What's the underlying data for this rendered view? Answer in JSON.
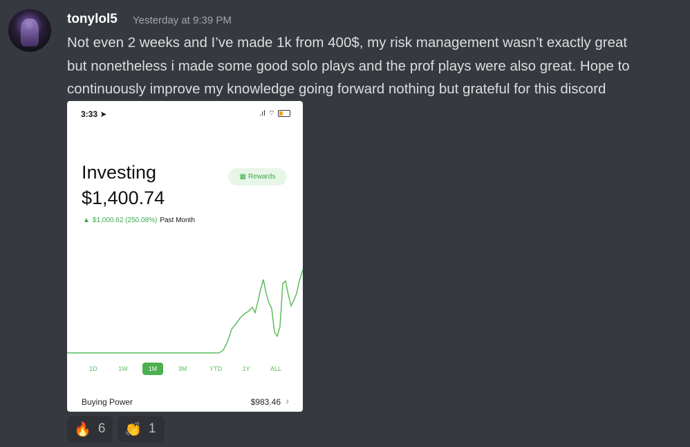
{
  "message": {
    "username": "tonylol5",
    "timestamp": "Yesterday at 9:39 PM",
    "lines": [
      "Not even 2 weeks and I’ve made 1k from 400$, my risk management wasn’t exactly great",
      "but nonetheless i made some good solo plays and the prof plays were also great. Hope to",
      "continuously improve my knowledge going forward nothing but grateful for this discord"
    ]
  },
  "attachment": {
    "status_time": "3:33",
    "title": "Investing",
    "value": "$1,400.74",
    "rewards_label": "Rewards",
    "change": "$1,000.62 (250.08%)",
    "change_period": "Past Month",
    "ranges": [
      "1D",
      "1W",
      "1M",
      "3M",
      "YTD",
      "1Y",
      "ALL"
    ],
    "active_range": "1M",
    "buying_power_label": "Buying Power",
    "buying_power_value": "$983.46",
    "accent_color": "#4caf50"
  },
  "reactions": [
    {
      "icon": "fire-icon",
      "emoji": "🔥",
      "count": "6"
    },
    {
      "icon": "clap-icon",
      "emoji": "👏",
      "count": "1"
    }
  ]
}
